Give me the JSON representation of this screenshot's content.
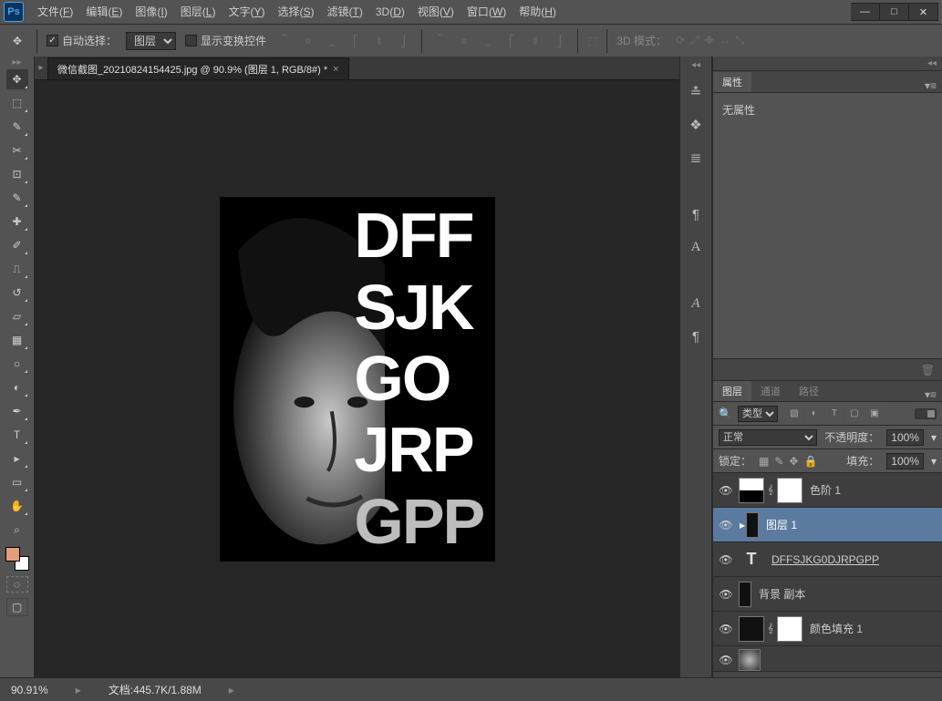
{
  "menu": {
    "items": [
      {
        "label": "文件",
        "hot": "F"
      },
      {
        "label": "编辑",
        "hot": "E"
      },
      {
        "label": "图像",
        "hot": "I"
      },
      {
        "label": "图层",
        "hot": "L"
      },
      {
        "label": "文字",
        "hot": "Y"
      },
      {
        "label": "选择",
        "hot": "S"
      },
      {
        "label": "滤镜",
        "hot": "T"
      },
      {
        "label": "3D",
        "hot": "D"
      },
      {
        "label": "视图",
        "hot": "V"
      },
      {
        "label": "窗口",
        "hot": "W"
      },
      {
        "label": "帮助",
        "hot": "H"
      }
    ]
  },
  "options": {
    "auto_select_label": "自动选择：",
    "auto_select_target": "图层",
    "show_transform_label": "显示变换控件",
    "mode3d_label": "3D 模式："
  },
  "doc": {
    "tab_title": "微信截图_20210824154425.jpg @ 90.9% (图层 1, RGB/8#) *",
    "artwork_lines": [
      "DFF",
      "SJK",
      "GO",
      "JRP",
      "GPP"
    ]
  },
  "panels": {
    "props_tab": "属性",
    "props_body": "无属性",
    "layers_tab": "图层",
    "channels_tab": "通道",
    "paths_tab": "路径",
    "filter_kind": "类型",
    "blend_mode": "正常",
    "opacity_label": "不透明度：",
    "opacity_value": "100%",
    "lock_label": "锁定：",
    "fill_label": "填充：",
    "fill_value": "100%",
    "layers": [
      {
        "name": "色阶 1",
        "sel": false,
        "type": "adj"
      },
      {
        "name": "图层 1",
        "sel": true,
        "type": "img",
        "clip": true
      },
      {
        "name": "DFFSJKG0DJRPGPP",
        "sel": false,
        "type": "text"
      },
      {
        "name": "背景 副本",
        "sel": false,
        "type": "imgblack"
      },
      {
        "name": "颜色填充 1",
        "sel": false,
        "type": "fill"
      }
    ]
  },
  "status": {
    "zoom": "90.91%",
    "docinfo": "文档:445.7K/1.88M"
  }
}
